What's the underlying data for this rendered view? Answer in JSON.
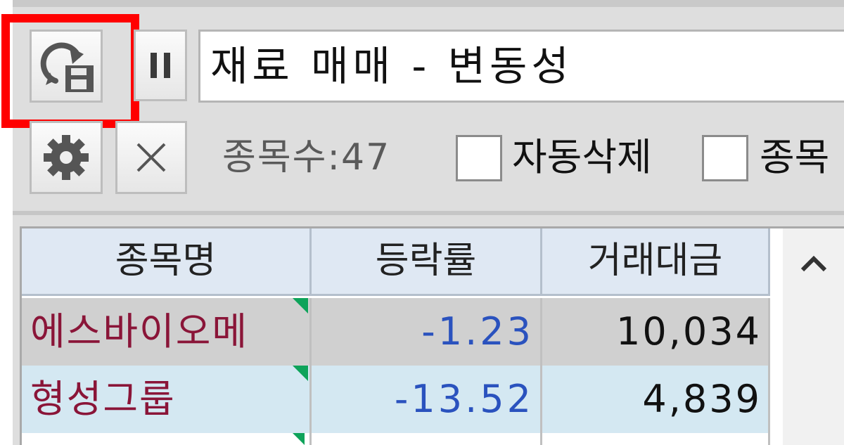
{
  "toolbar": {
    "title_value": "재료 매매 - 변동성",
    "count_text": "종목수:47",
    "autodelete_label": "자동삭제",
    "stock_label_partial": "종목",
    "autodelete_checked": false,
    "stock_checked": false
  },
  "icons": {
    "refresh": "refresh-save-icon",
    "pause": "pause-icon",
    "settings": "gear-icon",
    "close": "close-icon",
    "scroll_up": "chevron-up-icon",
    "row_flag": "green-corner-flag-icon"
  },
  "table": {
    "headers": [
      "종목명",
      "등락률",
      "거래대금"
    ],
    "rows": [
      {
        "name": "에스바이오메",
        "rate": "-1.23",
        "amount": "10,034"
      },
      {
        "name": "형성그룹",
        "rate": "-13.52",
        "amount": "4,839"
      },
      {
        "name": "",
        "rate": "",
        "amount": ""
      }
    ]
  },
  "colors": {
    "highlight": "#ff0000",
    "stock_name": "#8a1538",
    "negative_rate": "#2a52be",
    "selected_row": "#d4e8f2",
    "header_bg": "#dfe8f3",
    "flag": "#0ea35a"
  }
}
